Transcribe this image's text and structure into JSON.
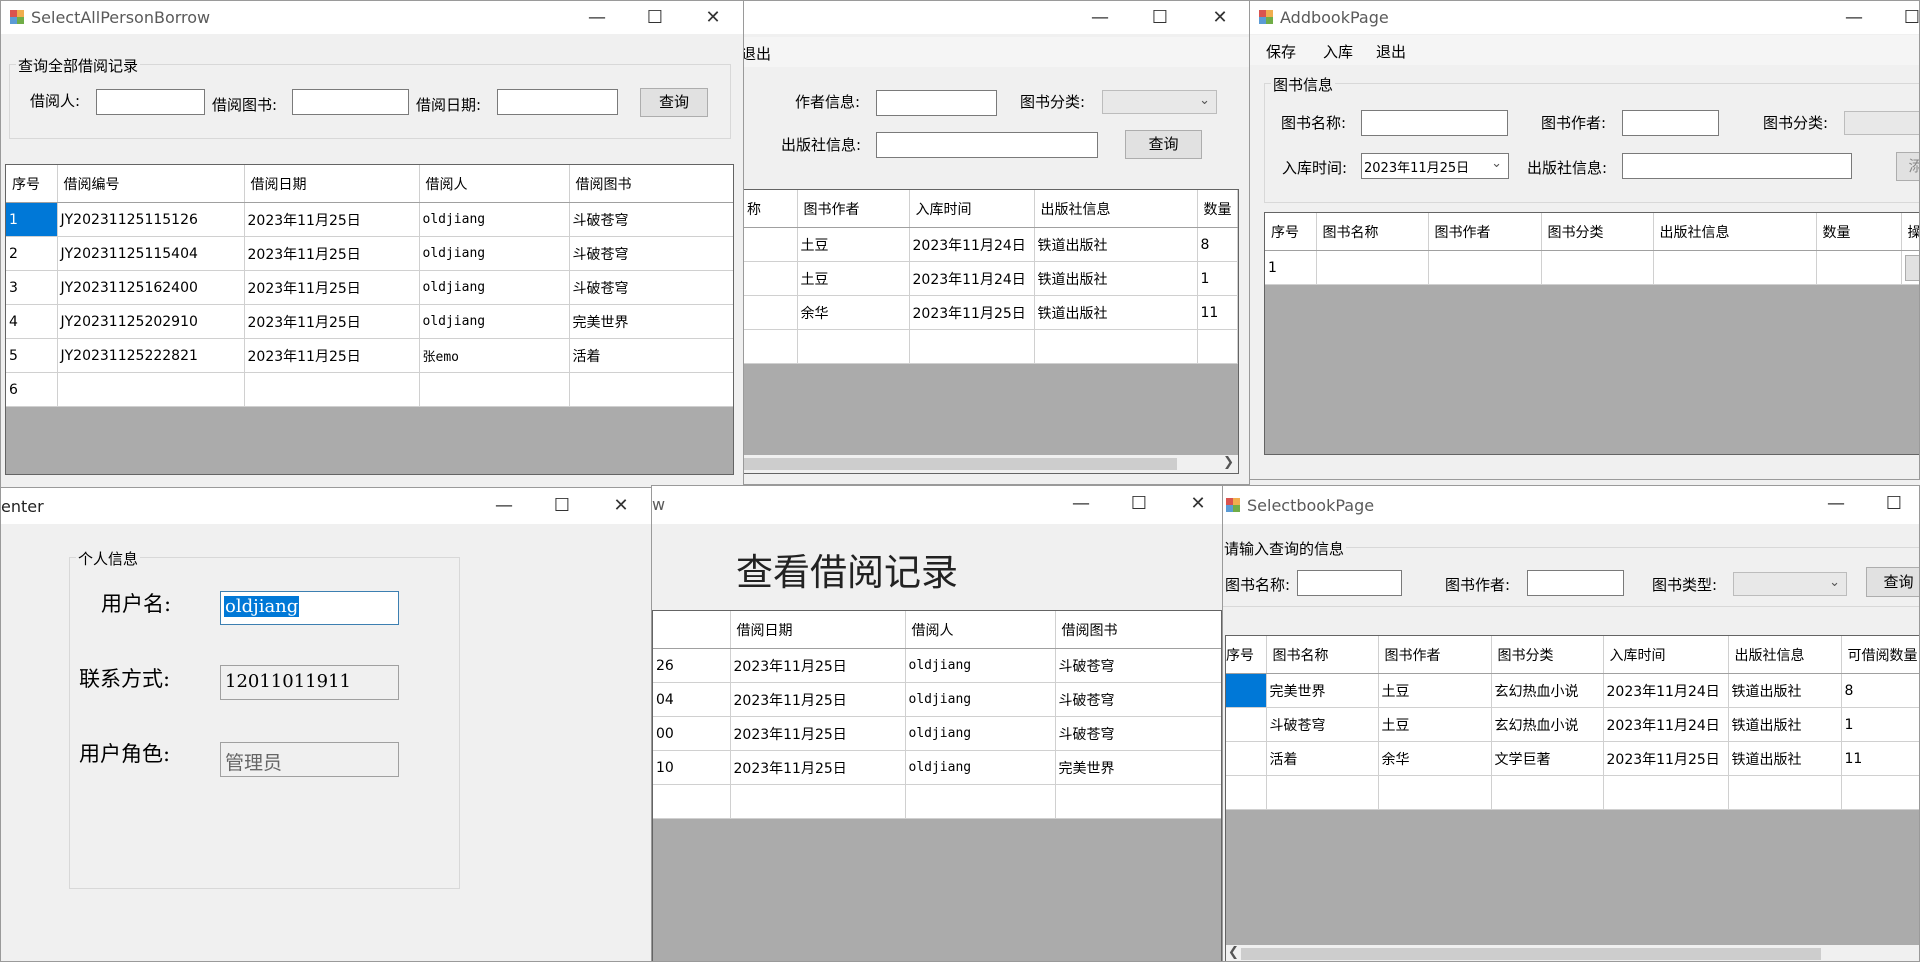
{
  "win_books": {
    "menu": {
      "exit": "退出"
    },
    "author_label": "作者信息:",
    "category_label": "图书分类:",
    "publisher_label": "出版社信息:",
    "query_button": "查询",
    "columns": [
      "称",
      "图书作者",
      "入库时间",
      "出版社信息",
      "数量"
    ],
    "rows": [
      [
        "",
        "土豆",
        "2023年11月24日",
        "铁道出版社",
        "8"
      ],
      [
        "",
        "土豆",
        "2023年11月24日",
        "铁道出版社",
        "1"
      ],
      [
        "",
        "余华",
        "2023年11月25日",
        "铁道出版社",
        "11"
      ],
      [
        "",
        "",
        "",
        "",
        ""
      ]
    ]
  },
  "win_select_all": {
    "title": "SelectAllPersonBorrow",
    "group_caption": "查询全部借阅记录",
    "borrower_label": "借阅人:",
    "book_label": "借阅图书:",
    "date_label": "借阅日期:",
    "query_button": "查询",
    "columns": [
      "序号",
      "借阅编号",
      "借阅日期",
      "借阅人",
      "借阅图书"
    ],
    "rows": [
      [
        "1",
        "JY20231125115126",
        "2023年11月25日",
        "oldjiang",
        "斗破苍穹"
      ],
      [
        "2",
        "JY20231125115404",
        "2023年11月25日",
        "oldjiang",
        "斗破苍穹"
      ],
      [
        "3",
        "JY20231125162400",
        "2023年11月25日",
        "oldjiang",
        "斗破苍穹"
      ],
      [
        "4",
        "JY20231125202910",
        "2023年11月25日",
        "oldjiang",
        "完美世界"
      ],
      [
        "5",
        "JY20231125222821",
        "2023年11月25日",
        "张emo",
        "活着"
      ],
      [
        "6",
        "",
        "",
        "",
        ""
      ]
    ]
  },
  "win_addbook": {
    "title": "AddbookPage",
    "menu": {
      "save": "保存",
      "stock": "入库",
      "exit": "退出"
    },
    "group_caption": "图书信息",
    "name_label": "图书名称:",
    "author_label": "图书作者:",
    "category_label": "图书分类:",
    "stock_time_label": "入库时间:",
    "stock_time_value": "2023年11月25日",
    "publisher_label": "出版社信息:",
    "add_button": "添",
    "columns": [
      "序号",
      "图书名称",
      "图书作者",
      "图书分类",
      "出版社信息",
      "数量",
      "操"
    ],
    "rows": [
      [
        "1",
        "",
        "",
        "",
        "",
        "",
        ""
      ]
    ]
  },
  "win_user": {
    "title": "enter",
    "group_caption": "个人信息",
    "username_label": "用户名:",
    "username_value": "oldjiang",
    "contact_label": "联系方式:",
    "contact_value": "12011011911",
    "role_label": "用户角色:",
    "role_value": "管理员"
  },
  "win_my_borrow": {
    "title": "w",
    "heading": "查看借阅记录",
    "columns": [
      "借阅日期",
      "借阅人",
      "借阅图书"
    ],
    "rows": [
      [
        "26",
        "2023年11月25日",
        "oldjiang",
        "斗破苍穹"
      ],
      [
        "04",
        "2023年11月25日",
        "oldjiang",
        "斗破苍穹"
      ],
      [
        "00",
        "2023年11月25日",
        "oldjiang",
        "斗破苍穹"
      ],
      [
        "10",
        "2023年11月25日",
        "oldjiang",
        "完美世界"
      ],
      [
        "",
        "",
        "",
        "",
        ""
      ]
    ]
  },
  "win_selectbook": {
    "title": "SelectbookPage",
    "group_caption": "请输入查询的信息",
    "name_label": "图书名称:",
    "author_label": "图书作者:",
    "type_label": "图书类型:",
    "query_button": "查询",
    "columns": [
      "序号",
      "图书名称",
      "图书作者",
      "图书分类",
      "入库时间",
      "出版社信息",
      "可借阅数量"
    ],
    "rows": [
      [
        "",
        "完美世界",
        "土豆",
        "玄幻热血小说",
        "2023年11月24日",
        "铁道出版社",
        "8"
      ],
      [
        "",
        "斗破苍穹",
        "土豆",
        "玄幻热血小说",
        "2023年11月24日",
        "铁道出版社",
        "1"
      ],
      [
        "",
        "活着",
        "余华",
        "文学巨著",
        "2023年11月25日",
        "铁道出版社",
        "11"
      ],
      [
        "",
        "",
        "",
        "",
        "",
        "",
        ""
      ]
    ]
  }
}
